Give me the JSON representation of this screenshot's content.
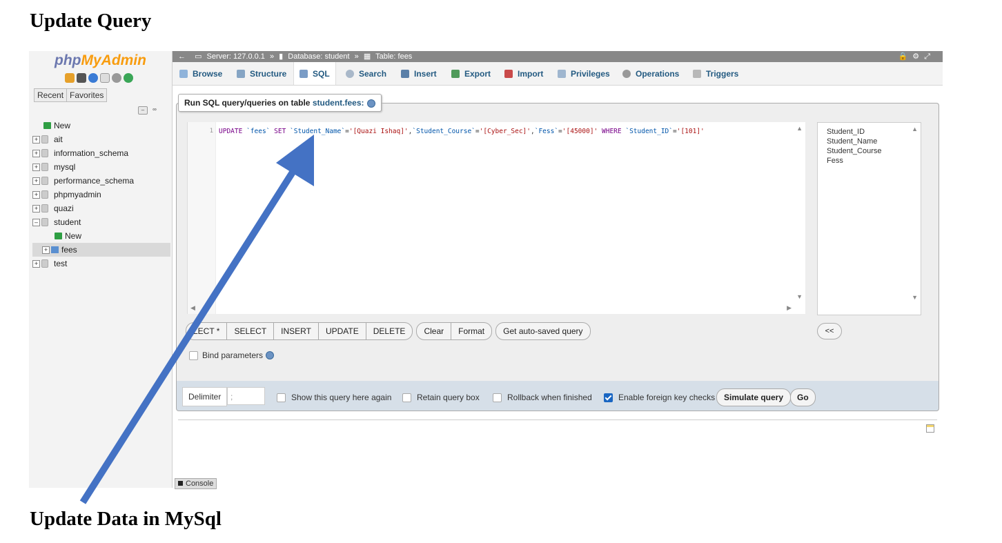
{
  "document": {
    "heading_top": "Update Query",
    "heading_bottom": "Update Data in MySql"
  },
  "nav": {
    "logo_part1": "php",
    "logo_part2": "MyAdmin",
    "tabs": [
      "Recent",
      "Favorites"
    ],
    "tree": [
      {
        "label": "New",
        "kind": "new"
      },
      {
        "label": "ait",
        "kind": "db"
      },
      {
        "label": "information_schema",
        "kind": "db"
      },
      {
        "label": "mysql",
        "kind": "db"
      },
      {
        "label": "performance_schema",
        "kind": "db"
      },
      {
        "label": "phpmyadmin",
        "kind": "db"
      },
      {
        "label": "quazi",
        "kind": "db"
      },
      {
        "label": "student",
        "kind": "db-open"
      },
      {
        "label": "New",
        "kind": "sub-new"
      },
      {
        "label": "fees",
        "kind": "sub-table"
      },
      {
        "label": "test",
        "kind": "db"
      }
    ]
  },
  "breadcrumb": {
    "server": "Server: 127.0.0.1",
    "database": "Database: student",
    "table": "Table: fees"
  },
  "tabs": [
    "Browse",
    "Structure",
    "SQL",
    "Search",
    "Insert",
    "Export",
    "Import",
    "Privileges",
    "Operations",
    "Triggers"
  ],
  "sql_panel": {
    "legend_prefix": "Run SQL query/queries on table ",
    "legend_table": "student.fees:",
    "line_number": "1",
    "query": {
      "kw_update": "UPDATE",
      "t_fees": "`fees`",
      "kw_set": "SET",
      "c_name": "`Student_Name`",
      "v_name": "'[Quazi Ishaq]'",
      "c_course": "`Student_Course`",
      "v_course": "'[Cyber_Sec]'",
      "c_fess": "`Fess`",
      "v_fess": "'[45000]'",
      "kw_where": "WHERE",
      "c_id": "`Student_ID`",
      "v_id": "'[101]'"
    },
    "columns": [
      "Student_ID",
      "Student_Name",
      "Student_Course",
      "Fess"
    ],
    "buttons_group1": [
      "LECT *",
      "SELECT",
      "INSERT",
      "UPDATE",
      "DELETE"
    ],
    "buttons_group2": [
      "Clear",
      "Format"
    ],
    "auto_saved": "Get auto-saved query",
    "collapse": "<<",
    "bind_parameters": "Bind parameters"
  },
  "footer": {
    "delimiter_label": "Delimiter",
    "delimiter_value": ";",
    "show_query_again": "Show this query here again",
    "retain_query_box": "Retain query box",
    "rollback": "Rollback when finished",
    "foreign_keys": "Enable foreign key checks",
    "foreign_keys_checked": true,
    "simulate": "Simulate query",
    "go": "Go"
  },
  "console_label": "Console",
  "colors": {
    "accent": "#235a81",
    "logo_blue": "#6c78af",
    "logo_orange": "#f89c0e",
    "arrow": "#4472c4"
  }
}
